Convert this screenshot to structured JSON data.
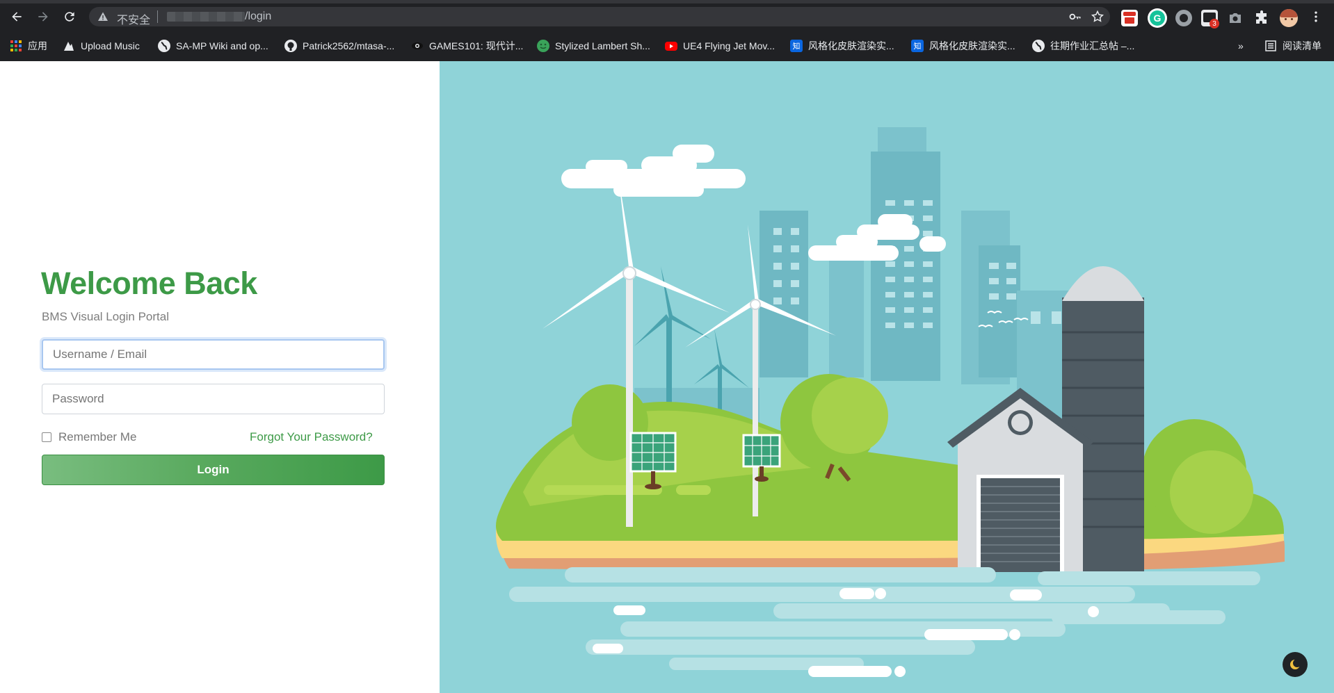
{
  "browser": {
    "address_bar": {
      "security_label": "不安全",
      "url_path": "/login"
    },
    "bookmarks": [
      {
        "label": "应用",
        "icon": "apps-grid-icon"
      },
      {
        "label": "Upload Music",
        "icon": "upload-music-icon"
      },
      {
        "label": "SA-MP Wiki and op...",
        "icon": "globe-icon"
      },
      {
        "label": "Patrick2562/mtasa-...",
        "icon": "github-icon"
      },
      {
        "label": "GAMES101: 现代计...",
        "icon": "eye-icon"
      },
      {
        "label": "Stylized Lambert Sh...",
        "icon": "smiley-icon"
      },
      {
        "label": "UE4 Flying Jet Mov...",
        "icon": "youtube-icon"
      },
      {
        "label": "风格化皮肤渲染实...",
        "icon": "zhihu-icon"
      },
      {
        "label": "风格化皮肤渲染实...",
        "icon": "zhihu-icon"
      },
      {
        "label": "往期作业汇总帖 –...",
        "icon": "globe-icon"
      }
    ],
    "bookmarks_overflow": "»",
    "reading_list_label": "阅读清单",
    "zhihu_glyph": "知",
    "extension_badge": "3",
    "colors": {
      "chrome_bg": "#202124",
      "omnibox_bg": "#35363a"
    }
  },
  "login": {
    "title": "Welcome Back",
    "subtitle": "BMS Visual Login Portal",
    "username_placeholder": "Username / Email",
    "password_placeholder": "Password",
    "remember_label": "Remember Me",
    "forgot_label": "Forgot Your Password?",
    "login_button": "Login"
  },
  "colors": {
    "brand_green": "#3d9a47",
    "illustration_bg": "#8fd3d8"
  }
}
